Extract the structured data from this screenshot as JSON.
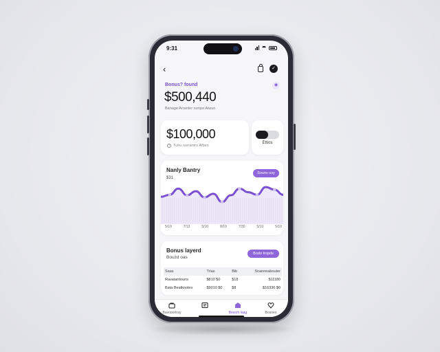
{
  "status": {
    "time": "9:31"
  },
  "nav": {
    "back": "‹",
    "profile_glyph": "✓"
  },
  "balance": {
    "label": "Bonus? found",
    "value": "$500,440",
    "subtitle": "Banage Arranter rumpe Aiwun",
    "eye_glyph": "◉"
  },
  "summary_card": {
    "value": "$100,000",
    "subtitle": "Tuhu ourrantro Afben",
    "info_glyph": "?"
  },
  "toggle_card": {
    "label": "Ettios"
  },
  "chart_card": {
    "title": "Nanly Bantry",
    "subtitle": "$31",
    "button_label": "Sounv uxy"
  },
  "chart_data": {
    "type": "area",
    "x": [
      "5/10",
      "7/13",
      "5/10",
      "8/10",
      "7/30",
      "5/10",
      "5/10"
    ],
    "series": [
      {
        "values": [
          4.0,
          4.4,
          5.6,
          4.3,
          5.1,
          3.9,
          4.6,
          3.0,
          4.3,
          5.6,
          4.9,
          4.4,
          5.9,
          5.4,
          4.4
        ]
      }
    ],
    "ylim": [
      0,
      7
    ],
    "colors": {
      "line": "#7a4fd1",
      "fill": "#cfc1f0"
    }
  },
  "recent_card": {
    "title": "Bonus layerd",
    "subtitle": "Bouzd oas",
    "button_label": "Bodo tropds",
    "table": {
      "header": [
        "Saas",
        "Trias",
        "Bib",
        "Snanneabouter"
      ],
      "rows": [
        [
          "Ravatantouns",
          "$810 $0",
          "$18",
          "$11180"
        ],
        [
          "Bata Beatknotes",
          "$9010 $0",
          "$8",
          "$16330 $0"
        ]
      ]
    }
  },
  "tabs": [
    {
      "label": "Bavooortray",
      "icon": "wallet-icon"
    },
    {
      "label": "",
      "icon": "document-icon"
    },
    {
      "label": "Besom laag",
      "icon": "home-icon"
    },
    {
      "label": "Bosnes",
      "icon": "heart-icon"
    }
  ],
  "colors": {
    "accent": "#8e66d9",
    "accent_text": "#7a4fd1",
    "bg": "#f6f6f8"
  }
}
